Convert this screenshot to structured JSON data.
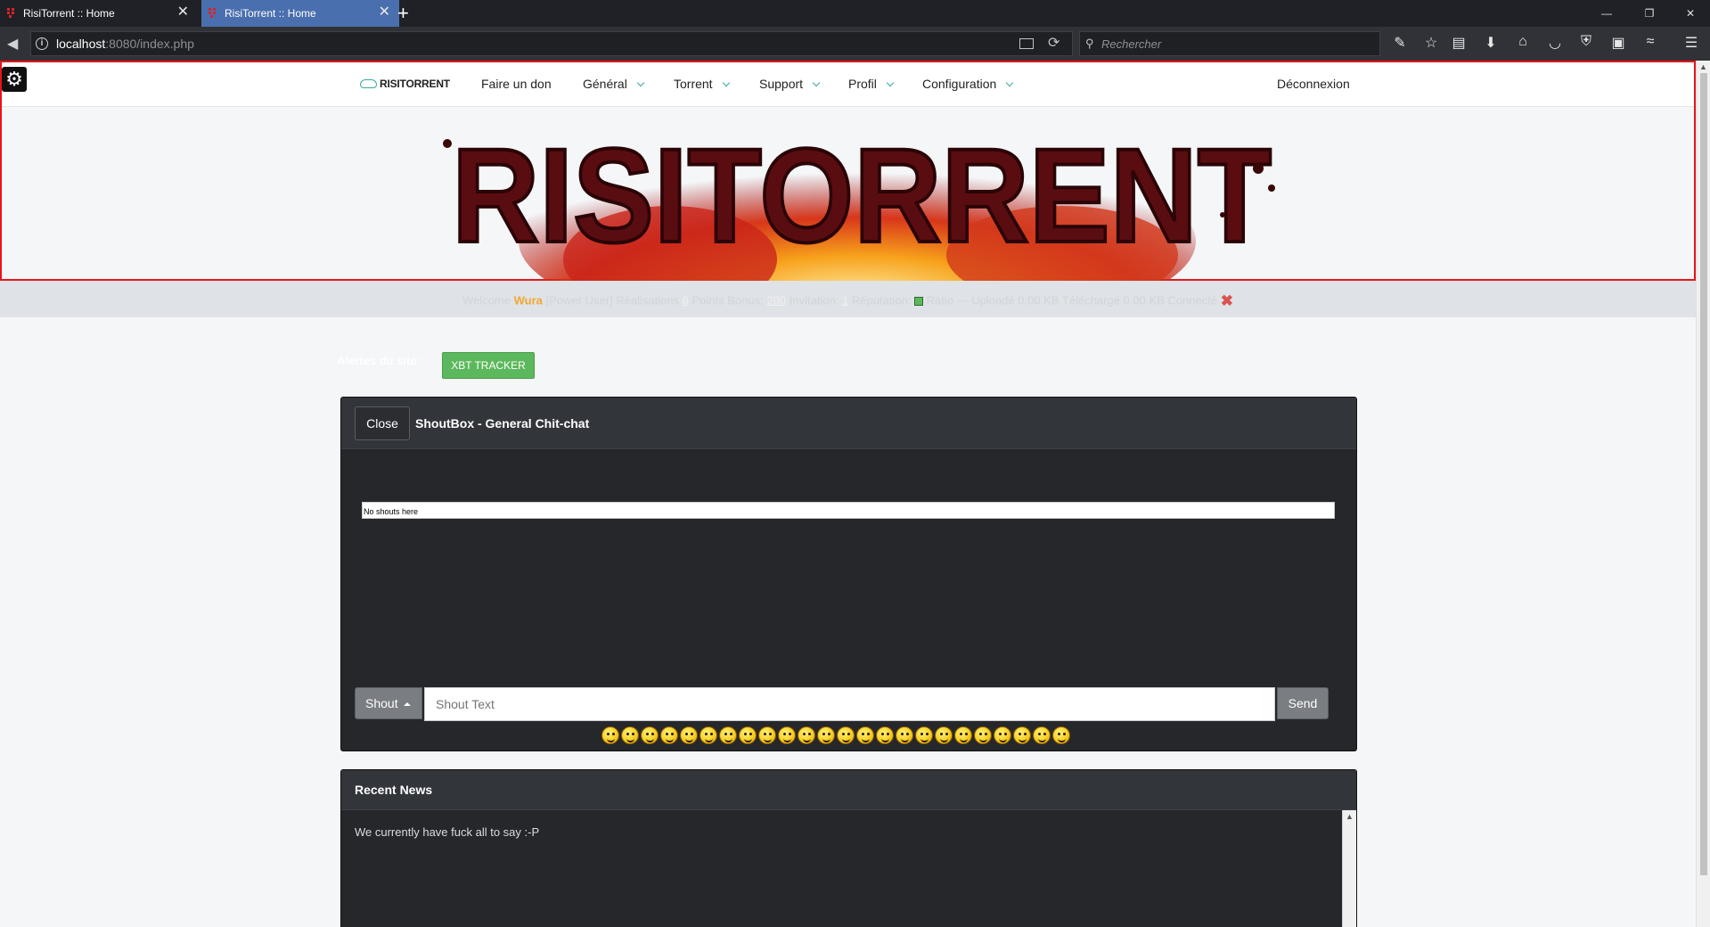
{
  "browser": {
    "tabs": [
      {
        "title": "RisiTorrent :: Home",
        "active": false
      },
      {
        "title": "RisiTorrent :: Home",
        "active": true
      }
    ],
    "new_tab_label": "+",
    "url_host": "localhost",
    "url_path": ":8080/index.php",
    "search_placeholder": "Rechercher"
  },
  "nav": {
    "brand": "RISITORRENT",
    "links": [
      {
        "label": "Faire un don",
        "dropdown": false
      },
      {
        "label": "Général",
        "dropdown": true
      },
      {
        "label": "Torrent",
        "dropdown": true
      },
      {
        "label": "Support",
        "dropdown": true
      },
      {
        "label": "Profil",
        "dropdown": true
      },
      {
        "label": "Configuration",
        "dropdown": true
      }
    ],
    "logout": "Déconnexion"
  },
  "banner": {
    "logo_text": "RISITORRENT"
  },
  "status": {
    "welcome": "Welcome",
    "username": "Wura",
    "role": "[Power User]",
    "achievements_label": "Réalisations",
    "achievements": "6",
    "bonus_label": "Points Bonus:",
    "bonus": "200",
    "invitation_label": "Invitation:",
    "invitation": "1",
    "reputation_label": "Réputation:",
    "ratio_text": "Ratio — Uploadé 0.00 KB Téléchargé 0.00 KB Connecté"
  },
  "alerts": {
    "label": "Alertes du site:",
    "badge": "XBT TRACKER"
  },
  "shoutbox": {
    "close_label": "Close",
    "title": "ShoutBox - General Chit-chat",
    "empty_message": "No shouts here",
    "shout_label": "Shout",
    "input_placeholder": "Shout Text",
    "send_label": "Send"
  },
  "news": {
    "title": "Recent News",
    "body": "We currently have fuck all to say :-P"
  },
  "colors": {
    "accent": "#3aa8a0",
    "header_frame": "#e8141b",
    "username": "#f0a830",
    "success": "#5cb85c",
    "panel_bg": "#25272b",
    "tab_active": "#4a6fae"
  }
}
